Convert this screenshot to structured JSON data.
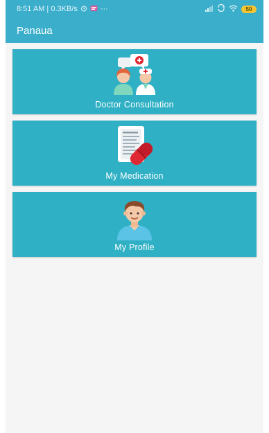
{
  "status_bar": {
    "time_info": "8:51 AM | 0.3KB/s",
    "more": "···",
    "battery_level": "50",
    "icons": [
      "alarm-icon",
      "notification-icon",
      "signal-icon",
      "sync-icon",
      "wifi-icon"
    ]
  },
  "app_bar": {
    "title": "Panaua"
  },
  "menu": {
    "items": [
      {
        "label": "Doctor Consultation",
        "icon": "doctor-consultation-icon"
      },
      {
        "label": "My Medication",
        "icon": "medication-icon"
      },
      {
        "label": "My Profile",
        "icon": "profile-icon"
      }
    ]
  },
  "colors": {
    "primary": "#3aaecb",
    "tile": "#2fb0c4",
    "background": "#f5f5f5",
    "pill_red": "#e02835",
    "battery": "#f4c531"
  }
}
